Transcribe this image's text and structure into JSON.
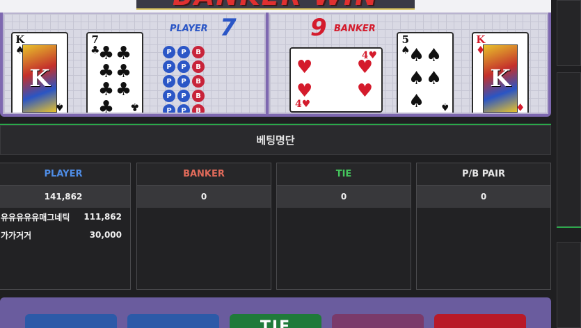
{
  "board": {
    "banner_text": "BANKER WIN",
    "player": {
      "label": "PLAYER",
      "score": "7"
    },
    "banker": {
      "label": "BANKER",
      "score": "9"
    },
    "bead_rows": [
      [
        "P",
        "P",
        "B"
      ],
      [
        "P",
        "P",
        "B"
      ],
      [
        "P",
        "P",
        "B"
      ],
      [
        "P",
        "P",
        "B"
      ],
      [
        "P",
        "P",
        "B"
      ]
    ],
    "player_cards": [
      {
        "rank": "K",
        "suit": "♠",
        "color": "black",
        "face": true
      },
      {
        "rank": "7",
        "suit": "♣",
        "color": "black",
        "face": false,
        "pips": 7
      },
      {
        "rank": "4",
        "suit": "♥",
        "color": "red",
        "face": false,
        "pips": 4,
        "rotated": true
      }
    ],
    "banker_cards": [
      {
        "rank": "5",
        "suit": "♠",
        "color": "black",
        "face": false,
        "pips": 5
      },
      {
        "rank": "K",
        "suit": "♦",
        "color": "red",
        "face": true
      }
    ]
  },
  "betting_list": {
    "title": "베팅명단",
    "columns": [
      {
        "name": "PLAYER",
        "color": "#4f8de6",
        "total": "141,862",
        "bets": [
          {
            "user": "유유유유유매그네틱",
            "amount": "111,862"
          },
          {
            "user": "가가거거",
            "amount": "30,000"
          }
        ]
      },
      {
        "name": "BANKER",
        "color": "#e06a5a",
        "total": "0",
        "bets": []
      },
      {
        "name": "TIE",
        "color": "#44c45c",
        "total": "0",
        "bets": []
      },
      {
        "name": "P/B PAIR",
        "color": "#e6e6e6",
        "total": "0",
        "bets": []
      }
    ]
  },
  "bet_buttons": [
    {
      "label": "",
      "color": "#2c5aa8"
    },
    {
      "label": "",
      "color": "#2c5aa8"
    },
    {
      "label": "TIE",
      "color": "#1f7a3a"
    },
    {
      "label": "",
      "color": "#7a3a6a"
    },
    {
      "label": "",
      "color": "#b81a28"
    }
  ]
}
